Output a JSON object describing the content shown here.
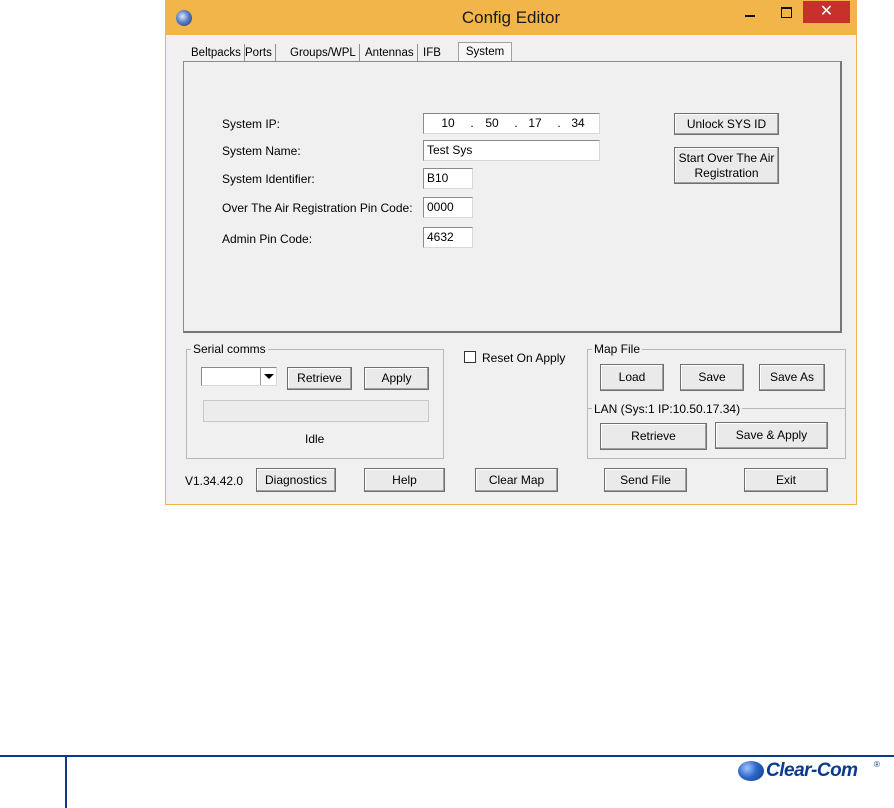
{
  "window": {
    "title": "Config Editor",
    "close_glyph": "✕",
    "icon": "app-globe-icon"
  },
  "tabs": [
    "Beltpacks",
    "Ports",
    "Groups/WPL",
    "Antennas",
    "IFB",
    "System"
  ],
  "active_tab": "System",
  "system": {
    "ip_label": "System IP:",
    "ip": [
      "10",
      "50",
      "17",
      "34"
    ],
    "name_label": "System Name:",
    "name_value": "Test Sys",
    "identifier_label": "System Identifier:",
    "identifier_value": "B10",
    "ota_pin_label": "Over The Air Registration Pin Code:",
    "ota_pin_value": "0000",
    "admin_pin_label": "Admin Pin Code:",
    "admin_pin_value": "4632",
    "unlock_button": "Unlock SYS ID",
    "start_over_button_line1": "Start Over The Air",
    "start_over_button_line2": "Registration"
  },
  "serial_comms": {
    "legend": "Serial comms",
    "port_value": "",
    "retrieve_button": "Retrieve",
    "apply_button": "Apply",
    "status": "Idle"
  },
  "reset_on_apply": {
    "label": "Reset On Apply",
    "checked": false
  },
  "map_file": {
    "legend": "Map File",
    "load_button": "Load",
    "save_button": "Save",
    "save_as_button": "Save As"
  },
  "lan": {
    "legend": "LAN  (Sys:1 IP:10.50.17.34)",
    "retrieve_button": "Retrieve",
    "save_apply_button": "Save & Apply"
  },
  "bottom_bar": {
    "version": "V1.34.42.0",
    "diagnostics_button": "Diagnostics",
    "help_button": "Help",
    "clear_map_button": "Clear Map",
    "send_file_button": "Send File",
    "exit_button": "Exit"
  },
  "page_footer": {
    "logo_text": "Clear-Com",
    "logo_mark": "®",
    "brand_color": "#0a3b8c"
  },
  "colors": {
    "title_bar": "#f2b54a",
    "close_button": "#c7302b"
  }
}
